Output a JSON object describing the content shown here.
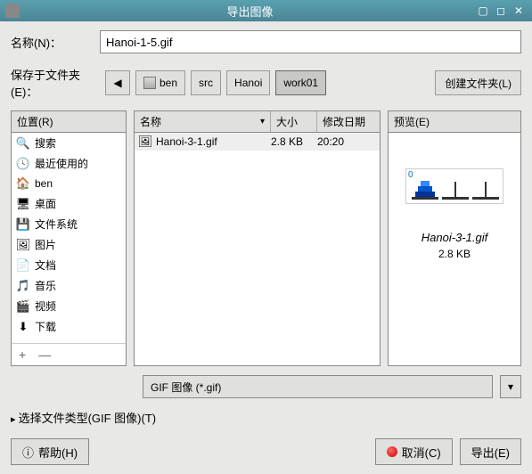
{
  "window": {
    "title": "导出图像"
  },
  "name": {
    "label": "名称(N)：",
    "value": "Hanoi-1-5.gif"
  },
  "save_in": {
    "label": "保存于文件夹(E)："
  },
  "path": [
    "ben",
    "src",
    "Hanoi",
    "work01"
  ],
  "create_folder": "创建文件夹(L)",
  "sidebar": {
    "header": "位置(R)",
    "items": [
      {
        "icon": "🔍",
        "label": "搜索"
      },
      {
        "icon": "🕓",
        "label": "最近使用的"
      },
      {
        "icon": "🏠",
        "label": "ben"
      },
      {
        "icon": "🖥",
        "label": "桌面"
      },
      {
        "icon": "💾",
        "label": "文件系统"
      },
      {
        "icon": "🖼",
        "label": "图片"
      },
      {
        "icon": "📄",
        "label": "文档"
      },
      {
        "icon": "🎵",
        "label": "音乐"
      },
      {
        "icon": "🎬",
        "label": "视频"
      },
      {
        "icon": "⬇",
        "label": "下载"
      }
    ],
    "add": "+",
    "remove": "—"
  },
  "filelist": {
    "cols": {
      "name": "名称",
      "size": "大小",
      "date": "修改日期"
    },
    "rows": [
      {
        "name": "Hanoi-3-1.gif",
        "size": "2.8 KB",
        "date": "20:20"
      }
    ]
  },
  "preview": {
    "header": "预览(E)",
    "name": "Hanoi-3-1.gif",
    "size": "2.8 KB",
    "badge": "0"
  },
  "filetype": {
    "label": "GIF 图像 (*.gif)"
  },
  "expand": "选择文件类型(GIF 图像)(T)",
  "buttons": {
    "help": "帮助(H)",
    "cancel": "取消(C)",
    "export": "导出(E)"
  }
}
